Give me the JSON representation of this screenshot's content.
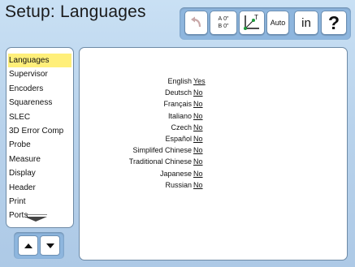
{
  "header": {
    "title": "Setup: Languages"
  },
  "toolbar": {
    "axis_a": "A",
    "axis_b": "B",
    "axis_a_value": "0\"",
    "axis_b_value": "0\"",
    "datum_label": "T",
    "auto_label": "Auto",
    "unit_label": "in",
    "help_label": "?"
  },
  "sidebar": {
    "items": [
      {
        "label": "Languages"
      },
      {
        "label": "Supervisor"
      },
      {
        "label": "Encoders"
      },
      {
        "label": "Squareness"
      },
      {
        "label": "SLEC"
      },
      {
        "label": "3D Error Comp"
      },
      {
        "label": "Probe"
      },
      {
        "label": "Measure"
      },
      {
        "label": "Display"
      },
      {
        "label": "Header"
      },
      {
        "label": "Print"
      },
      {
        "label": "Ports"
      }
    ],
    "active_index": 0
  },
  "languages": [
    {
      "name": "English",
      "value": "Yes"
    },
    {
      "name": "Deutsch",
      "value": "No"
    },
    {
      "name": "Français",
      "value": "No"
    },
    {
      "name": "Italiano",
      "value": "No"
    },
    {
      "name": "Czech",
      "value": "No"
    },
    {
      "name": "Español",
      "value": "No"
    },
    {
      "name": "Simplifed Chinese",
      "value": "No"
    },
    {
      "name": "Traditional Chinese",
      "value": "No"
    },
    {
      "name": "Japanese",
      "value": "No"
    },
    {
      "name": "Russian",
      "value": "No"
    }
  ],
  "colors": {
    "background": "#b9d3ec",
    "toolbar": "#8eb6de",
    "active_item": "#ffef7a",
    "panel": "#ffffff"
  },
  "icons": {
    "undo": "undo-arrow-icon",
    "datum": "datum-axes-icon",
    "scroll_down": "scroll-down-arrow-icon",
    "page_up": "up-arrow-icon",
    "page_down": "down-arrow-icon"
  }
}
